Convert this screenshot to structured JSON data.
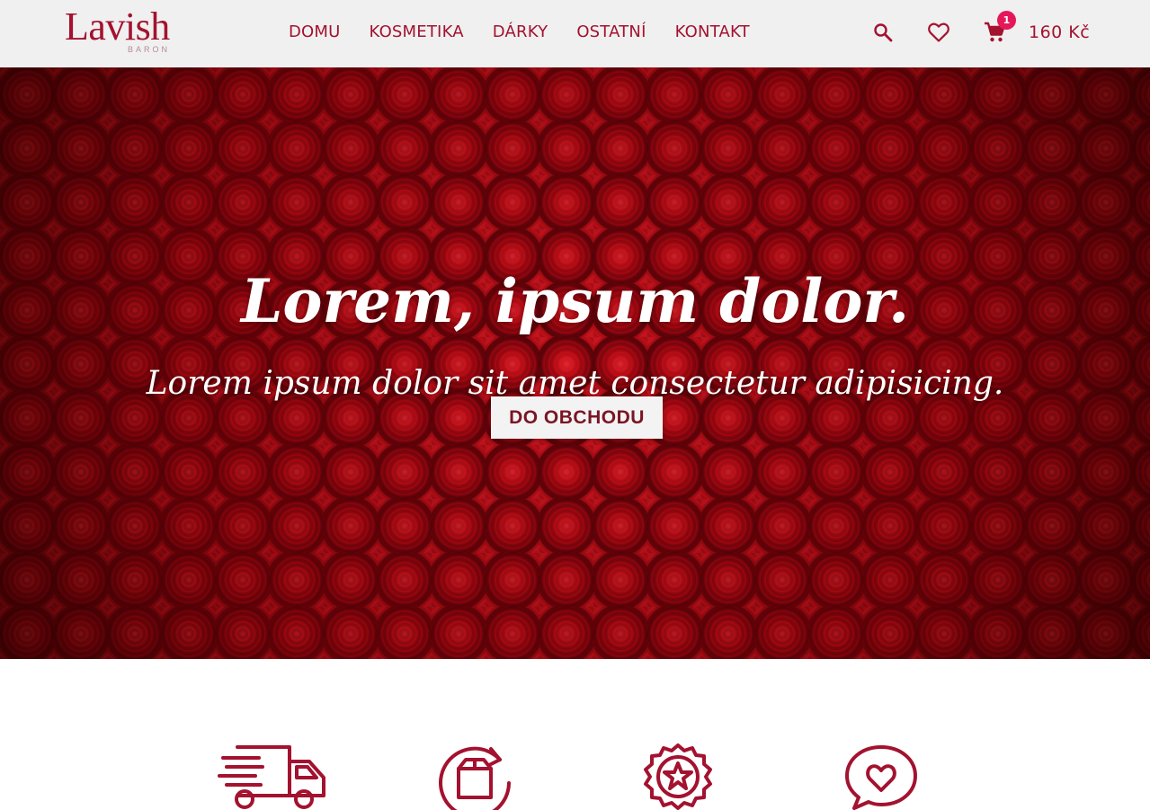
{
  "header": {
    "logo": {
      "word": "Lavish",
      "sub": "BARON"
    },
    "nav": [
      {
        "label": "DOMU"
      },
      {
        "label": "KOSMETIKA"
      },
      {
        "label": "DÁRKY"
      },
      {
        "label": "OSTATNÍ"
      },
      {
        "label": "KONTAKT"
      }
    ],
    "icons": {
      "search": "search-icon",
      "wishlist": "heart-icon",
      "cart": "cart-icon"
    },
    "cart_count": "1",
    "cart_total": "160 Kč"
  },
  "hero": {
    "title": "Lorem, ipsum dolor.",
    "subtitle": "Lorem ipsum dolor sit amet consectetur adipisicing.",
    "cta_label": "DO OBCHODU",
    "background": "red-roses-image"
  },
  "features": [
    {
      "icon": "delivery-truck-icon"
    },
    {
      "icon": "box-return-icon"
    },
    {
      "icon": "quality-badge-star-icon"
    },
    {
      "icon": "heart-speech-bubble-icon"
    }
  ],
  "colors": {
    "brand": "#a3122f",
    "header_bg": "#f0f0f0",
    "badge": "#e5175a",
    "cta_text": "#7a1524",
    "cta_bg": "#f3f3f3"
  }
}
